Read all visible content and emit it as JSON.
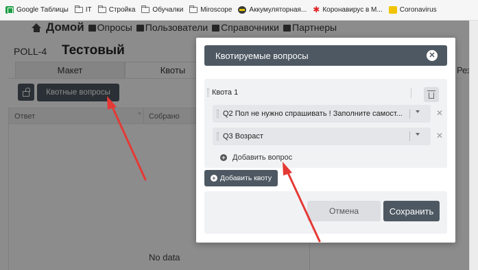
{
  "bookmarks": [
    {
      "label": "Google Таблицы",
      "icon": "sheets-icon"
    },
    {
      "label": "IT",
      "icon": "folder-icon"
    },
    {
      "label": "Стройка",
      "icon": "folder-icon"
    },
    {
      "label": "Обучалки",
      "icon": "folder-icon"
    },
    {
      "label": "Miroscope",
      "icon": "folder-icon"
    },
    {
      "label": "Аккумуляторная...",
      "icon": "battery-icon"
    },
    {
      "label": "Коронавирус в М...",
      "icon": "virus-icon"
    },
    {
      "label": "Coronavirus",
      "icon": "yellow-square-icon"
    }
  ],
  "nav": {
    "home": "Домой",
    "items": [
      "Опросы",
      "Пользователи",
      "Справочники",
      "Партнеры"
    ]
  },
  "poll": {
    "id": "POLL-4",
    "title": "Тестовый"
  },
  "tabs": [
    "Макет",
    "Квоты",
    "Рез"
  ],
  "toolbar": {
    "quota_questions_label": "Квотные вопросы"
  },
  "table": {
    "columns": [
      "Ответ",
      "Собрано"
    ],
    "empty_text": "No data"
  },
  "modal": {
    "title": "Квотируемые вопросы",
    "close_glyph": "✕",
    "quota": {
      "name": "Квота 1",
      "questions": [
        "Q2 Пол не нужно спрашивать ! Заполните самост...",
        "Q3 Возраст"
      ],
      "add_question_label": "Добавить вопрос"
    },
    "add_quota_label": "Добавить квоту",
    "cancel_label": "Отмена",
    "save_label": "Сохранить"
  },
  "colors": {
    "primary": "#4d5862",
    "panel": "#f1f2f4",
    "arrow": "#e53935"
  }
}
